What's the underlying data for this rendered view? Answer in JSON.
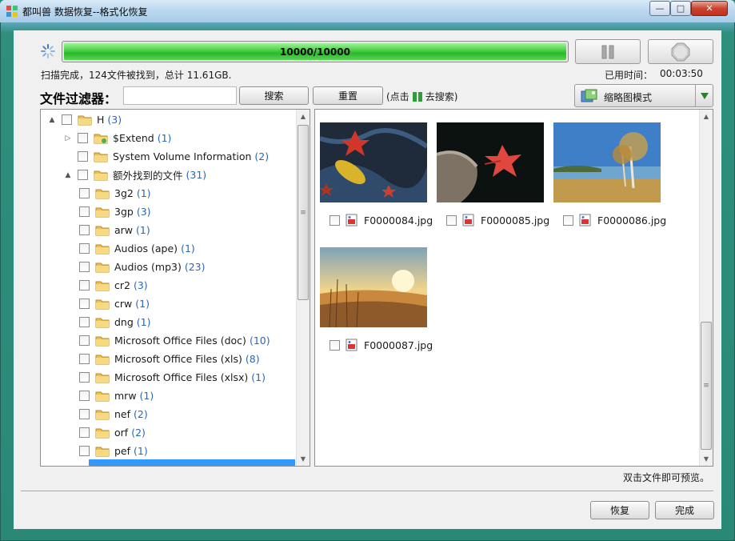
{
  "window": {
    "title": "都叫兽 数据恢复--格式化恢复",
    "minimize": "—",
    "maximize": "□",
    "close": "✕"
  },
  "scan": {
    "progress_text": "10000/10000",
    "progress_fraction": 1.0,
    "status": "扫描完成，124文件被找到，总计 11.61GB.",
    "elapsed_label": "已用时间：",
    "elapsed_value": "00:03:50"
  },
  "filter": {
    "label": "文件过滤器：",
    "input_value": "",
    "search_label": "搜索",
    "reset_label": "重置",
    "hint_prefix": "(点击",
    "hint_suffix": "去搜索)",
    "view_mode": "缩略图模式"
  },
  "tree": {
    "items": [
      {
        "label": "H",
        "count": "(3)",
        "expander": "▲"
      },
      {
        "label": "$Extend",
        "count": "(1)",
        "expander": "▷"
      },
      {
        "label": "System Volume Information",
        "count": "(2)",
        "expander": ""
      },
      {
        "label": "额外找到的文件",
        "count": "(31)",
        "expander": "▲"
      },
      {
        "label": "3g2",
        "count": "(1)"
      },
      {
        "label": "3gp",
        "count": "(3)"
      },
      {
        "label": "arw",
        "count": "(1)"
      },
      {
        "label": "Audios (ape)",
        "count": "(1)"
      },
      {
        "label": "Audios (mp3)",
        "count": "(23)"
      },
      {
        "label": "cr2",
        "count": "(3)"
      },
      {
        "label": "crw",
        "count": "(1)"
      },
      {
        "label": "dng",
        "count": "(1)"
      },
      {
        "label": "Microsoft Office Files (doc)",
        "count": "(10)"
      },
      {
        "label": "Microsoft Office Files (xls)",
        "count": "(8)"
      },
      {
        "label": "Microsoft Office Files (xlsx)",
        "count": "(1)"
      },
      {
        "label": "mrw",
        "count": "(1)"
      },
      {
        "label": "nef",
        "count": "(2)"
      },
      {
        "label": "orf",
        "count": "(2)"
      },
      {
        "label": "pef",
        "count": "(1)"
      }
    ]
  },
  "files": [
    {
      "name": "F0000084.jpg",
      "scene": "red-leaf-water"
    },
    {
      "name": "F0000085.jpg",
      "scene": "red-leaf-branch"
    },
    {
      "name": "F0000086.jpg",
      "scene": "birch-lake"
    },
    {
      "name": "F0000087.jpg",
      "scene": "sunset-field"
    }
  ],
  "footer": {
    "preview_hint": "双击文件即可预览。",
    "recover_label": "恢复",
    "done_label": "完成"
  },
  "colors": {
    "frame": "#2a8877",
    "progress": "#2bb82a",
    "count": "#2868b8",
    "selection": "#3399ff"
  }
}
